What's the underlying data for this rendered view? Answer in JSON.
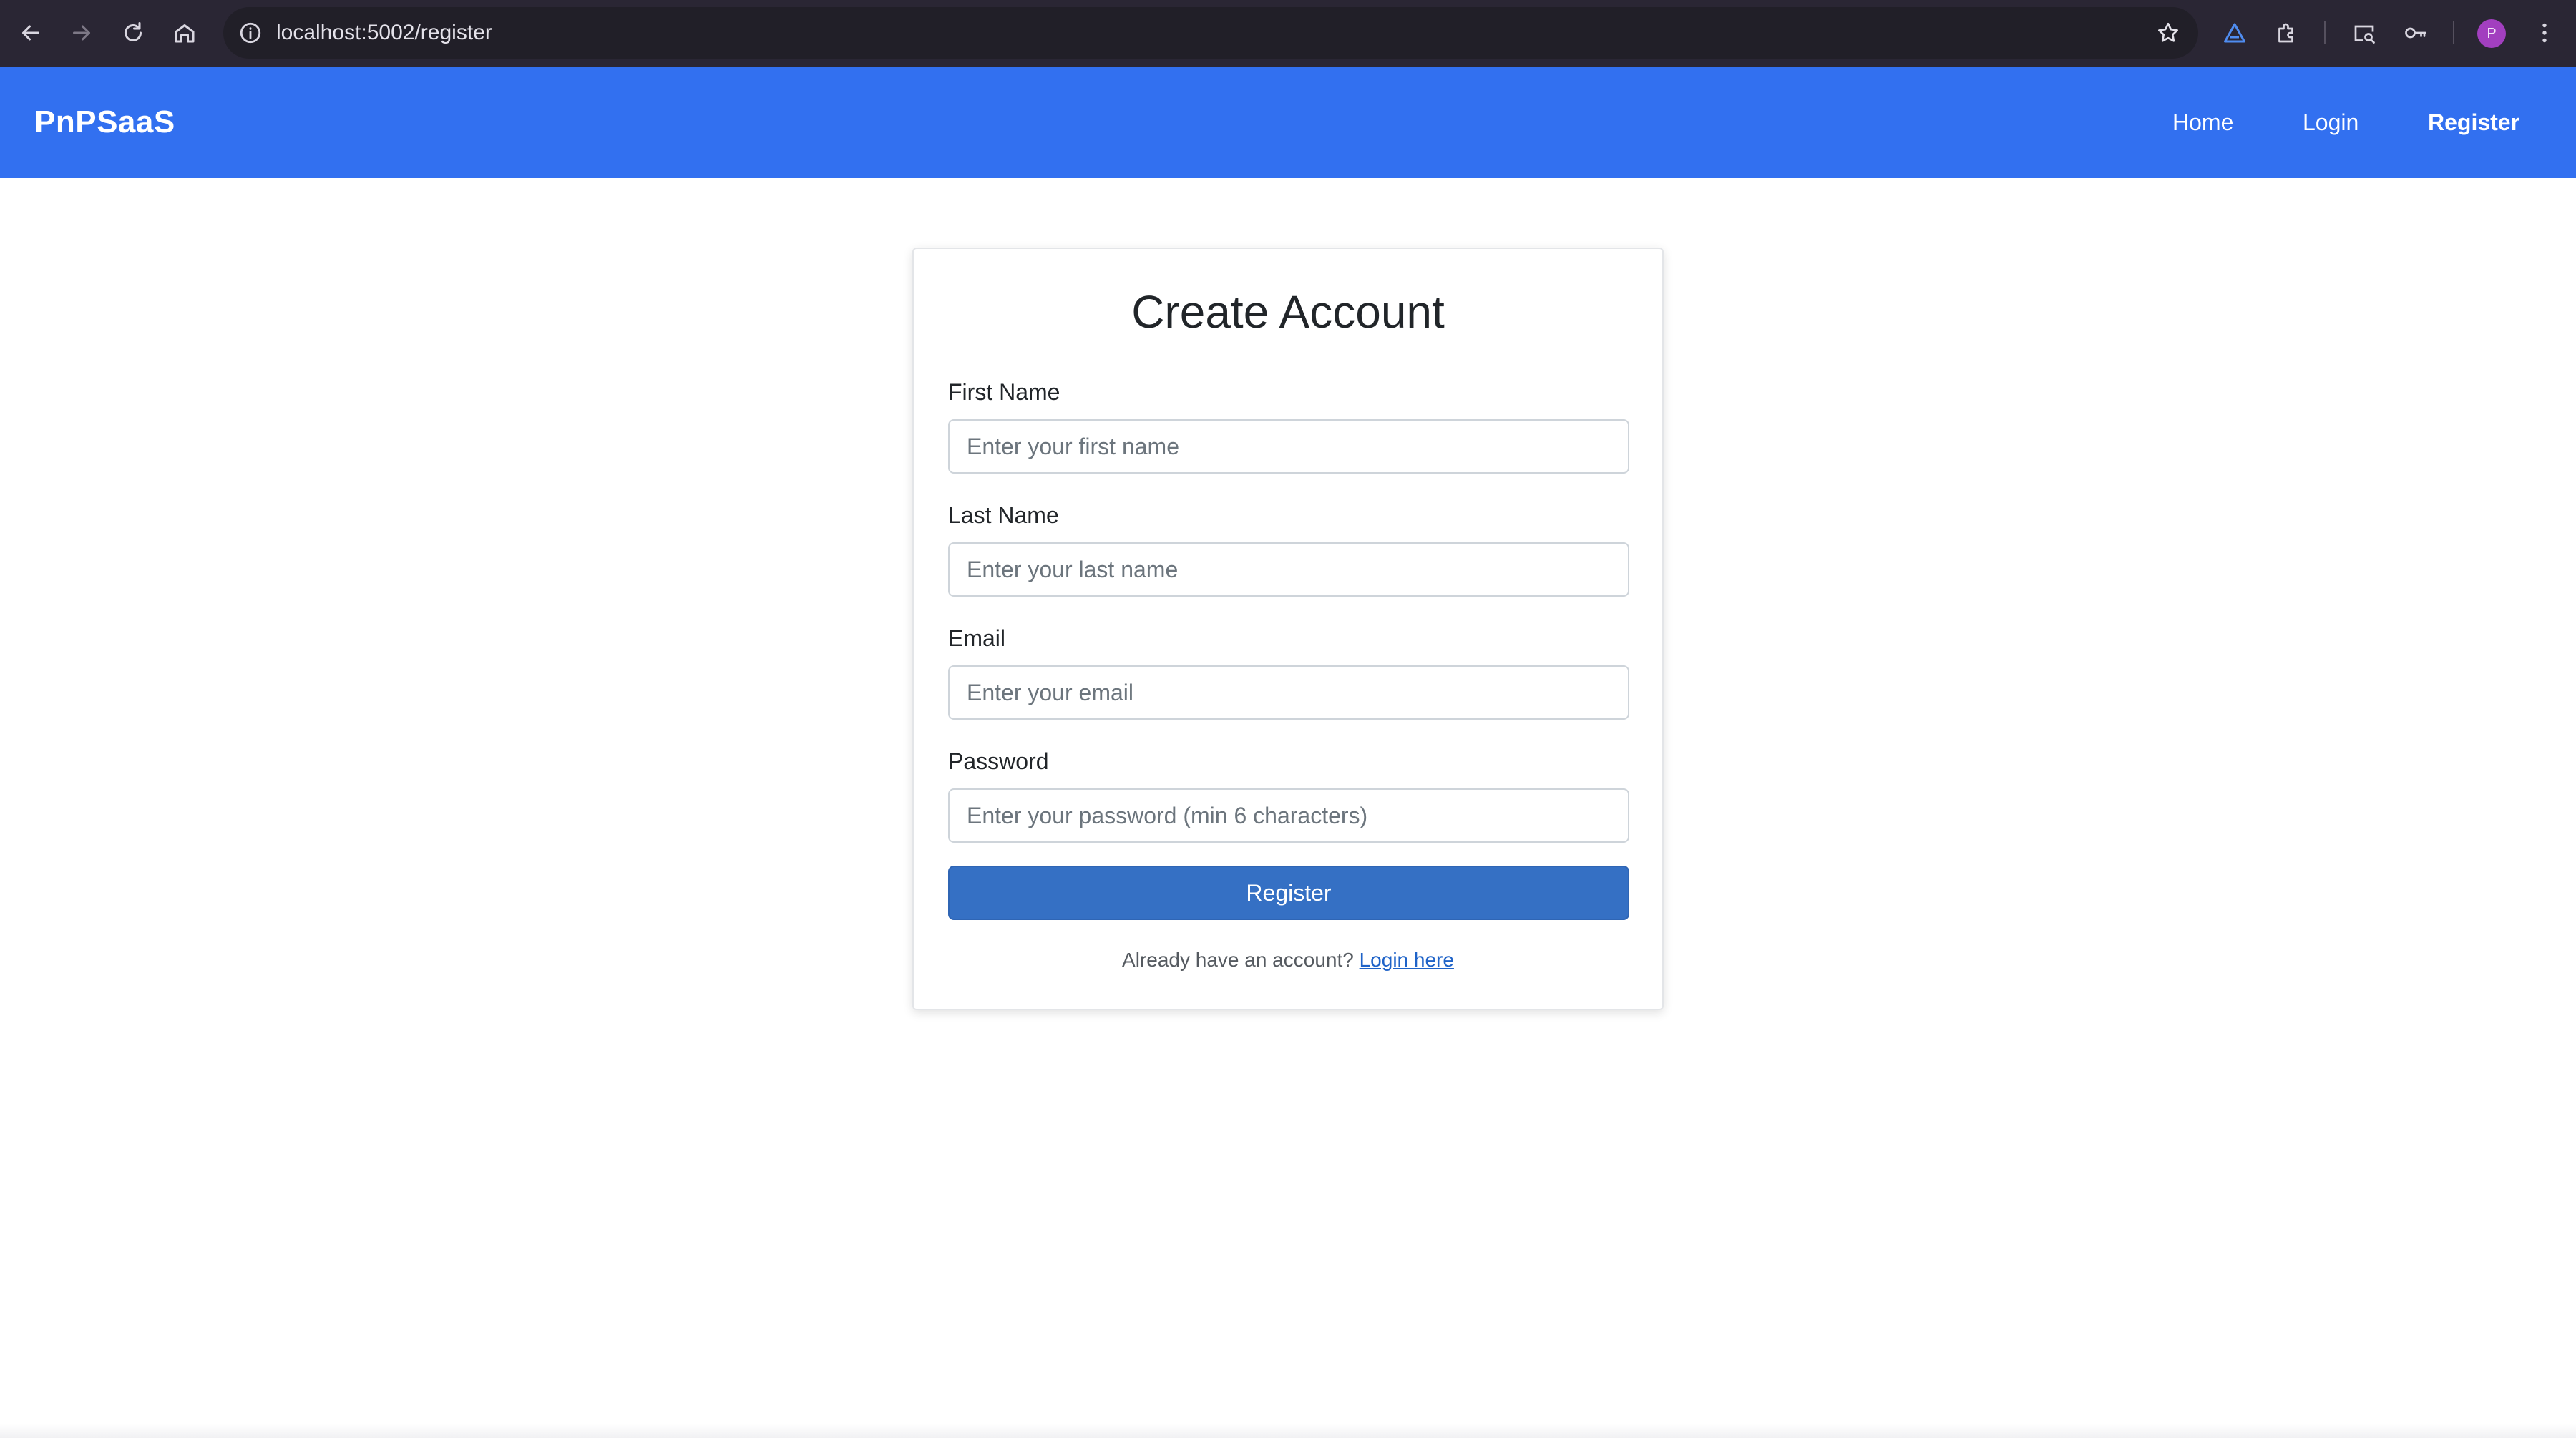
{
  "browser": {
    "url": "localhost:5002/register",
    "profile_initial": "P",
    "icons": [
      "back-icon",
      "forward-icon",
      "reload-icon",
      "home-icon",
      "site-info-icon",
      "bookmark-star-icon",
      "extension-triangle-icon",
      "extensions-puzzle-icon",
      "tab-search-icon",
      "password-key-icon",
      "menu-kebab-icon"
    ]
  },
  "site": {
    "brand": "PnPSaaS",
    "nav": {
      "home": "Home",
      "login": "Login",
      "register": "Register"
    },
    "colors": {
      "header": "#3270f0",
      "button": "#3570c4",
      "link": "#1f63c8"
    }
  },
  "form": {
    "title": "Create Account",
    "first_name": {
      "label": "First Name",
      "placeholder": "Enter your first name",
      "value": ""
    },
    "last_name": {
      "label": "Last Name",
      "placeholder": "Enter your last name",
      "value": ""
    },
    "email": {
      "label": "Email",
      "placeholder": "Enter your email",
      "value": ""
    },
    "password": {
      "label": "Password",
      "placeholder": "Enter your password (min 6 characters)",
      "value": ""
    },
    "submit_label": "Register",
    "footer_text": "Already have an account?",
    "footer_link": "Login here"
  }
}
